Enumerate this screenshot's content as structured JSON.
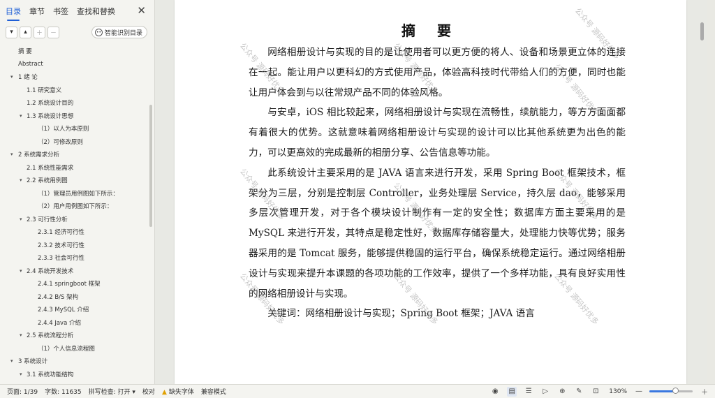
{
  "nav": {
    "tabs": [
      "目录",
      "章节",
      "书签",
      "查找和替换"
    ],
    "close_glyph": "✕",
    "smart_toc_label": "智能识别目录",
    "toc": [
      {
        "text": "摘    要",
        "level": 0,
        "arrow": false
      },
      {
        "text": "Abstract",
        "level": 0,
        "arrow": false
      },
      {
        "text": "1 绪    论",
        "level": 0,
        "arrow": true
      },
      {
        "text": "1.1 研究意义",
        "level": 1,
        "arrow": false
      },
      {
        "text": "1.2 系统设计目的",
        "level": 1,
        "arrow": false
      },
      {
        "text": "1.3 系统设计思想",
        "level": 1,
        "arrow": true
      },
      {
        "text": "（1）以人为本原则",
        "level": 2,
        "arrow": false
      },
      {
        "text": "（2）可修改原则",
        "level": 2,
        "arrow": false
      },
      {
        "text": "2 系统需求分析",
        "level": 0,
        "arrow": true
      },
      {
        "text": "2.1 系统性能需求",
        "level": 1,
        "arrow": false
      },
      {
        "text": "2.2 系统用例图",
        "level": 1,
        "arrow": true
      },
      {
        "text": "（1）管理员用例图如下所示：",
        "level": 2,
        "arrow": false
      },
      {
        "text": "（2）用户用例图如下所示：",
        "level": 2,
        "arrow": false
      },
      {
        "text": "2.3 可行性分析",
        "level": 1,
        "arrow": true
      },
      {
        "text": "2.3.1 经济可行性",
        "level": 2,
        "arrow": false
      },
      {
        "text": "2.3.2 技术可行性",
        "level": 2,
        "arrow": false
      },
      {
        "text": "2.3.3 社会可行性",
        "level": 2,
        "arrow": false
      },
      {
        "text": "2.4 系统开发技术",
        "level": 1,
        "arrow": true
      },
      {
        "text": "2.4.1    springboot 框架",
        "level": 2,
        "arrow": false
      },
      {
        "text": "2.4.2    B/S 架构",
        "level": 2,
        "arrow": false
      },
      {
        "text": "2.4.3 MySQL 介绍",
        "level": 2,
        "arrow": false
      },
      {
        "text": "2.4.4 Java 介绍",
        "level": 2,
        "arrow": false
      },
      {
        "text": "2.5 系统流程分析",
        "level": 1,
        "arrow": true
      },
      {
        "text": "（1）个人信息流程图",
        "level": 2,
        "arrow": false
      },
      {
        "text": "3 系统设计",
        "level": 0,
        "arrow": true
      },
      {
        "text": "3.1 系统功能结构",
        "level": 1,
        "arrow": true
      }
    ]
  },
  "document": {
    "title": "摘    要",
    "paragraphs": [
      "网络相册设计与实现的目的是让使用者可以更方便的将人、设备和场景更立体的连接在一起。能让用户以更科幻的方式使用产品，体验高科技时代带给人们的方便，同时也能让用户体会到与以往常规产品不同的体验风格。",
      "与安卓，iOS 相比较起来，网络相册设计与实现在流畅性，续航能力，等方方面面都有着很大的优势。这就意味着网络相册设计与实现的设计可以比其他系统更为出色的能力，可以更高效的完成最新的相册分享、公告信息等功能。",
      "此系统设计主要采用的是 JAVA 语言来进行开发，采用 Spring Boot 框架技术，框架分为三层，分别是控制层 Controller，业务处理层 Service，持久层 dao，能够采用多层次管理开发，对于各个模块设计制作有一定的安全性；数据库方面主要采用的是 MySQL 来进行开发，其特点是稳定性好，数据库存储容量大，处理能力快等优势；服务器采用的是 Tomcat 服务，能够提供稳固的运行平台，确保系统稳定运行。通过网络相册设计与实现来提升本课题的各项功能的工作效率，提供了一个多样功能，具有良好实用性的网络相册设计与实现。",
      "关键词：网络相册设计与实现；Spring Boot 框架；JAVA 语言"
    ],
    "watermark": "公众号 源码好优多"
  },
  "status": {
    "page": "页面: 1/39",
    "words": "字数: 11635",
    "spell": "拼写检查: 打开 ▾",
    "proof": "校对",
    "missing_font": "缺失字体",
    "compat": "兼容模式",
    "zoom": "130%",
    "zoom_level": 0.6
  }
}
